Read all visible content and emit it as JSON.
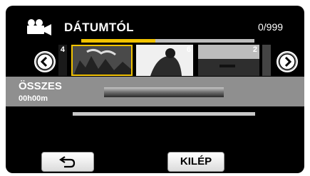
{
  "header": {
    "mode_icon": "movie-camera-icon",
    "title": "DÁTUMTÓL",
    "counter": "0/999"
  },
  "navigation": {
    "prev_icon": "chevron-left-icon",
    "next_icon": "chevron-right-icon"
  },
  "thumbnails": [
    {
      "label": "4"
    },
    {
      "label": ""
    },
    {
      "label": "6"
    },
    {
      "label": "2"
    },
    {
      "label": ""
    }
  ],
  "info": {
    "label": "ÖSSZES",
    "duration": "00h00m"
  },
  "footer": {
    "back_icon": "return-arrow-icon",
    "exit_label": "KILÉP"
  },
  "colors": {
    "accent": "#f2c300",
    "band": "#8f8f8f"
  }
}
